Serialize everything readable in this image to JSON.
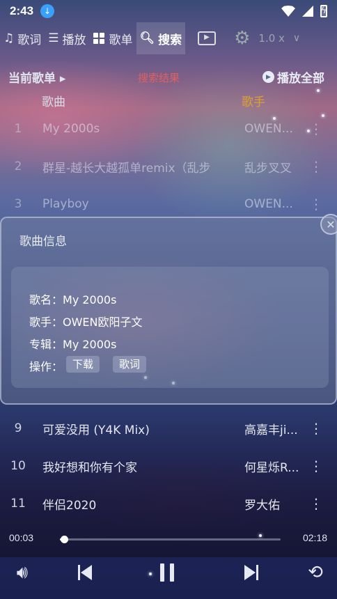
{
  "status_bar": {
    "time": "2:43",
    "download_badge": "download-icon"
  },
  "tabs": [
    {
      "icon": "music-note-icon",
      "label": "歌词"
    },
    {
      "icon": "list-icon",
      "label": "播放"
    },
    {
      "icon": "grid-icon",
      "label": "歌单"
    },
    {
      "icon": "search-icon",
      "label": "搜索",
      "active": true
    }
  ],
  "toolbar": {
    "speed": "1.0 x"
  },
  "list_header": {
    "current_list": "当前歌单",
    "current_list_arrow": "▸",
    "search_result": "搜索结果",
    "play_all": "播放全部"
  },
  "columns": {
    "song": "歌曲",
    "artist": "歌手"
  },
  "songs_top": [
    {
      "index": "1",
      "title": "My 2000s",
      "artist": "OWEN..."
    },
    {
      "index": "2",
      "title": "群星-越长大越孤单remix（乱步",
      "artist": "乱步叉叉"
    },
    {
      "index": "3",
      "title": "Playboy",
      "artist": "OWEN..."
    }
  ],
  "songs_bottom": [
    {
      "index": "9",
      "title": "可爱没用 (Y4K Mix)",
      "artist": "高嘉丰ji..."
    },
    {
      "index": "10",
      "title": "我好想和你有个家",
      "artist": "何星烁R..."
    },
    {
      "index": "11",
      "title": "伴侣2020",
      "artist": "罗大佑"
    }
  ],
  "dialog": {
    "title": "歌曲信息",
    "name_label": "歌名：",
    "name_value": "My 2000s",
    "singer_label": "歌手：",
    "singer_value": "OWEN欧阳子文",
    "album_label": "专辑：",
    "album_value": "My 2000s",
    "action_label": "操作：",
    "download_button": "下载",
    "lyrics_button": "歌词"
  },
  "player": {
    "current_time": "00:03",
    "total_time": "02:18",
    "progress": 0.02
  },
  "colors": {
    "accent_artist_header": "#e0a030",
    "search_result_red": "#e06060"
  }
}
